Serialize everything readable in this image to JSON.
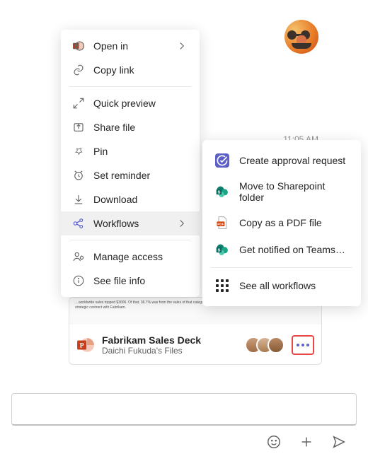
{
  "timestamp": "11:05 AM",
  "file": {
    "title": "Fabrikam Sales Deck",
    "subtitle": "Daichi Fukuda's Files",
    "preview_text": "…worldwide sales topped $3006. Of that, 36.7% was from the sales of that category. 62.5% of Worldwide sales were of Fabrikam products due to… strategic contract with Fabrikam."
  },
  "menu": {
    "open_in": "Open in",
    "copy_link": "Copy link",
    "quick_preview": "Quick preview",
    "share_file": "Share file",
    "pin": "Pin",
    "set_reminder": "Set reminder",
    "download": "Download",
    "workflows": "Workflows",
    "manage_access": "Manage access",
    "see_file_info": "See file info"
  },
  "submenu": {
    "create_approval": "Create approval request",
    "move_sharepoint": "Move to Sharepoint folder",
    "copy_pdf": "Copy as a PDF file",
    "get_notified": "Get notified on Teams…",
    "see_all": "See all workflows"
  },
  "compose": {
    "placeholder": ""
  }
}
